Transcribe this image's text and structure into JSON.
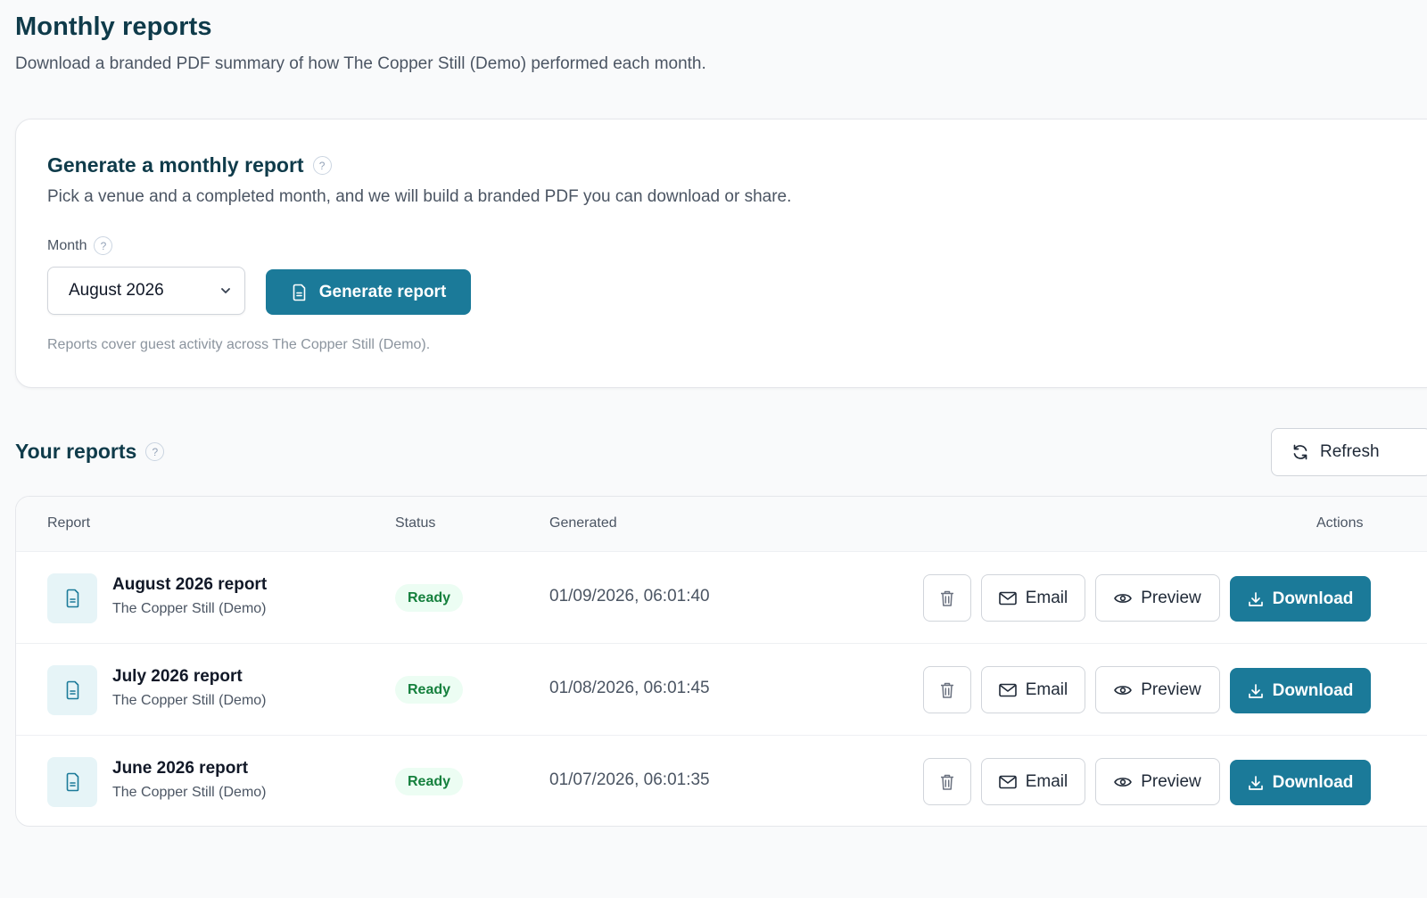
{
  "header": {
    "title": "Monthly reports",
    "subtitle": "Download a branded PDF summary of how The Copper Still (Demo) performed each month."
  },
  "generate": {
    "title": "Generate a monthly report",
    "description": "Pick a venue and a completed month, and we will build a branded PDF you can download or share.",
    "month_label": "Month",
    "month_value": "August 2026",
    "button_label": "Generate report",
    "note": "Reports cover guest activity across The Copper Still (Demo).",
    "help_glyph": "?"
  },
  "reports": {
    "title": "Your reports",
    "refresh_label": "Refresh",
    "columns": {
      "report": "Report",
      "status": "Status",
      "generated": "Generated",
      "actions": "Actions"
    },
    "rows": [
      {
        "name": "August 2026 report",
        "venue": "The Copper Still (Demo)",
        "status": "Ready",
        "generated": "01/09/2026, 06:01:40"
      },
      {
        "name": "July 2026 report",
        "venue": "The Copper Still (Demo)",
        "status": "Ready",
        "generated": "01/08/2026, 06:01:45"
      },
      {
        "name": "June 2026 report",
        "venue": "The Copper Still (Demo)",
        "status": "Ready",
        "generated": "01/07/2026, 06:01:35"
      }
    ],
    "actions": {
      "email": "Email",
      "preview": "Preview",
      "download": "Download"
    }
  },
  "colors": {
    "primary": "#1b7a99",
    "heading": "#0f3b4a",
    "status_ready_text": "#15803d",
    "status_ready_bg": "#ecfdf3"
  },
  "icons": {
    "help": "help-icon",
    "select": "chevron-down-icon",
    "generate": "file-icon",
    "refresh": "refresh-icon",
    "row": "file-icon",
    "delete": "trash-icon",
    "email": "mail-icon",
    "preview": "eye-icon",
    "download": "download-icon"
  }
}
